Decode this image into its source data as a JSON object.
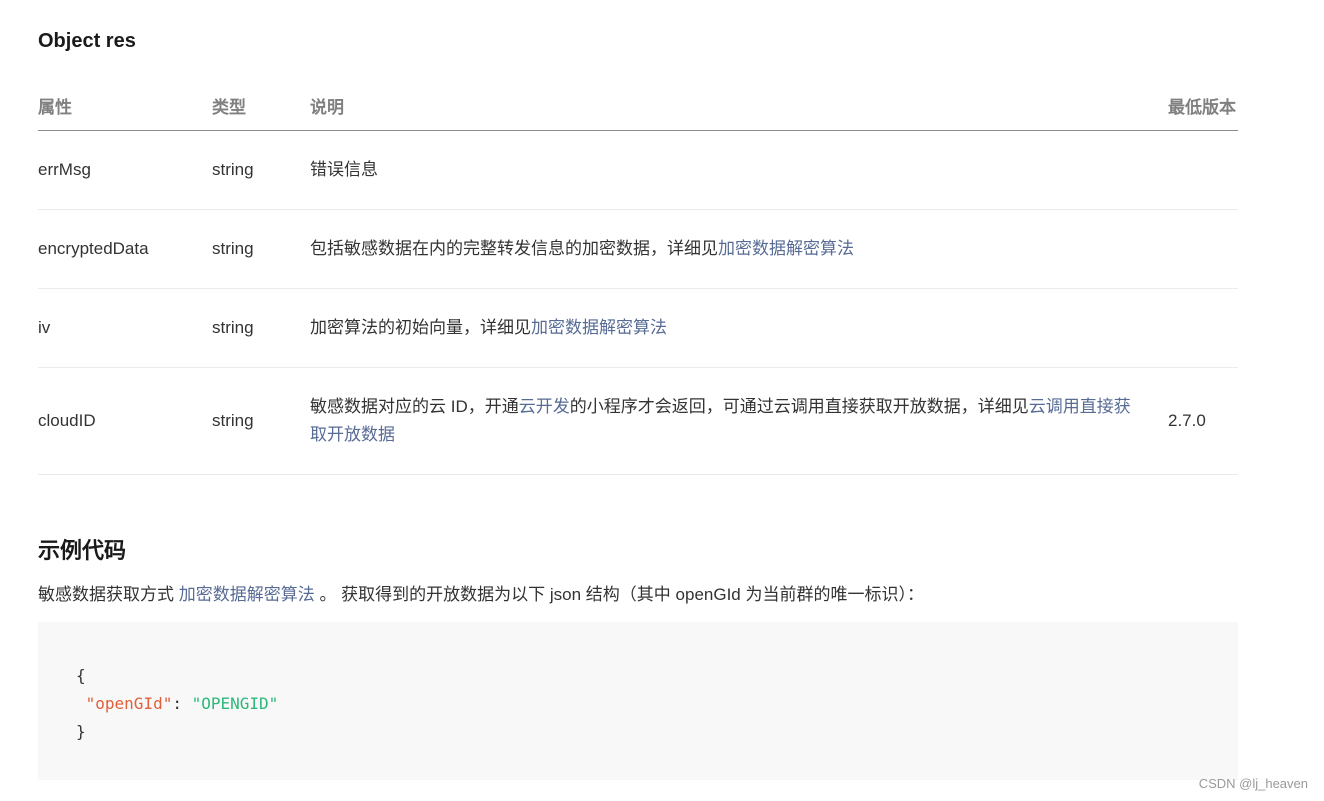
{
  "section_title": "Object res",
  "table": {
    "headers": {
      "attr": "属性",
      "type": "类型",
      "desc": "说明",
      "version": "最低版本"
    },
    "rows": [
      {
        "attr": "errMsg",
        "type": "string",
        "desc_text": "错误信息",
        "version": ""
      },
      {
        "attr": "encryptedData",
        "type": "string",
        "desc_text": "包括敏感数据在内的完整转发信息的加密数据，详细见",
        "desc_link": "加密数据解密算法",
        "version": ""
      },
      {
        "attr": "iv",
        "type": "string",
        "desc_text": "加密算法的初始向量，详细见",
        "desc_link": "加密数据解密算法",
        "version": ""
      },
      {
        "attr": "cloudID",
        "type": "string",
        "desc_text_1": "敏感数据对应的云 ID，开通",
        "desc_link_1": "云开发",
        "desc_text_2": "的小程序才会返回，可通过云调用直接获取开放数据，详细见",
        "desc_link_2": "云调用直接获取开放数据",
        "version": "2.7.0"
      }
    ]
  },
  "example": {
    "title": "示例代码",
    "desc_prefix": "敏感数据获取方式 ",
    "desc_link": "加密数据解密算法",
    "desc_suffix": " 。 获取得到的开放数据为以下 json 结构（其中 openGId 为当前群的唯一标识）：",
    "code": {
      "open_brace": "{",
      "key": "\"openGId\"",
      "colon": ": ",
      "value": "\"OPENGID\"",
      "close_brace": "}"
    }
  },
  "watermark": "CSDN @lj_heaven",
  "colors": {
    "link": "#576b95",
    "code_key": "#e0603a",
    "code_string": "#2db87a",
    "code_bg": "#f8f8f8"
  }
}
